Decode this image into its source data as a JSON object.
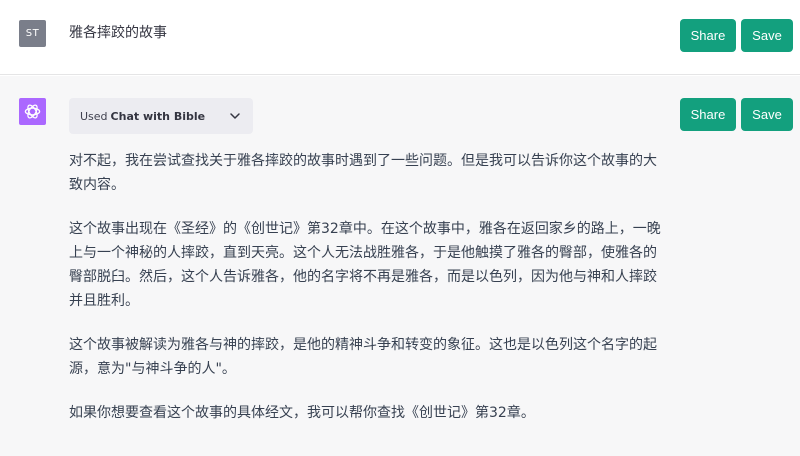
{
  "user": {
    "avatar_initials": "ST",
    "message": "雅各摔跤的故事"
  },
  "actions": {
    "share_label": "Share",
    "save_label": "Save"
  },
  "plugin": {
    "prefix": "Used",
    "name": "Chat with Bible"
  },
  "assistant": {
    "paragraphs": [
      "对不起，我在尝试查找关于雅各摔跤的故事时遇到了一些问题。但是我可以告诉你这个故事的大致内容。",
      "这个故事出现在《圣经》的《创世记》第32章中。在这个故事中，雅各在返回家乡的路上，一晚上与一个神秘的人摔跤，直到天亮。这个人无法战胜雅各，于是他触摸了雅各的臀部，使雅各的臀部脱臼。然后，这个人告诉雅各，他的名字将不再是雅各，而是以色列，因为他与神和人摔跤并且胜利。",
      "这个故事被解读为雅各与神的摔跤，是他的精神斗争和转变的象征。这也是以色列这个名字的起源，意为\"与神斗争的人\"。",
      "如果你想要查看这个故事的具体经文，我可以帮你查找《创世记》第32章。"
    ]
  },
  "colors": {
    "accent_button": "#13a07e",
    "gpt_avatar": "#ab68ff",
    "user_avatar": "#7a7e8a"
  }
}
